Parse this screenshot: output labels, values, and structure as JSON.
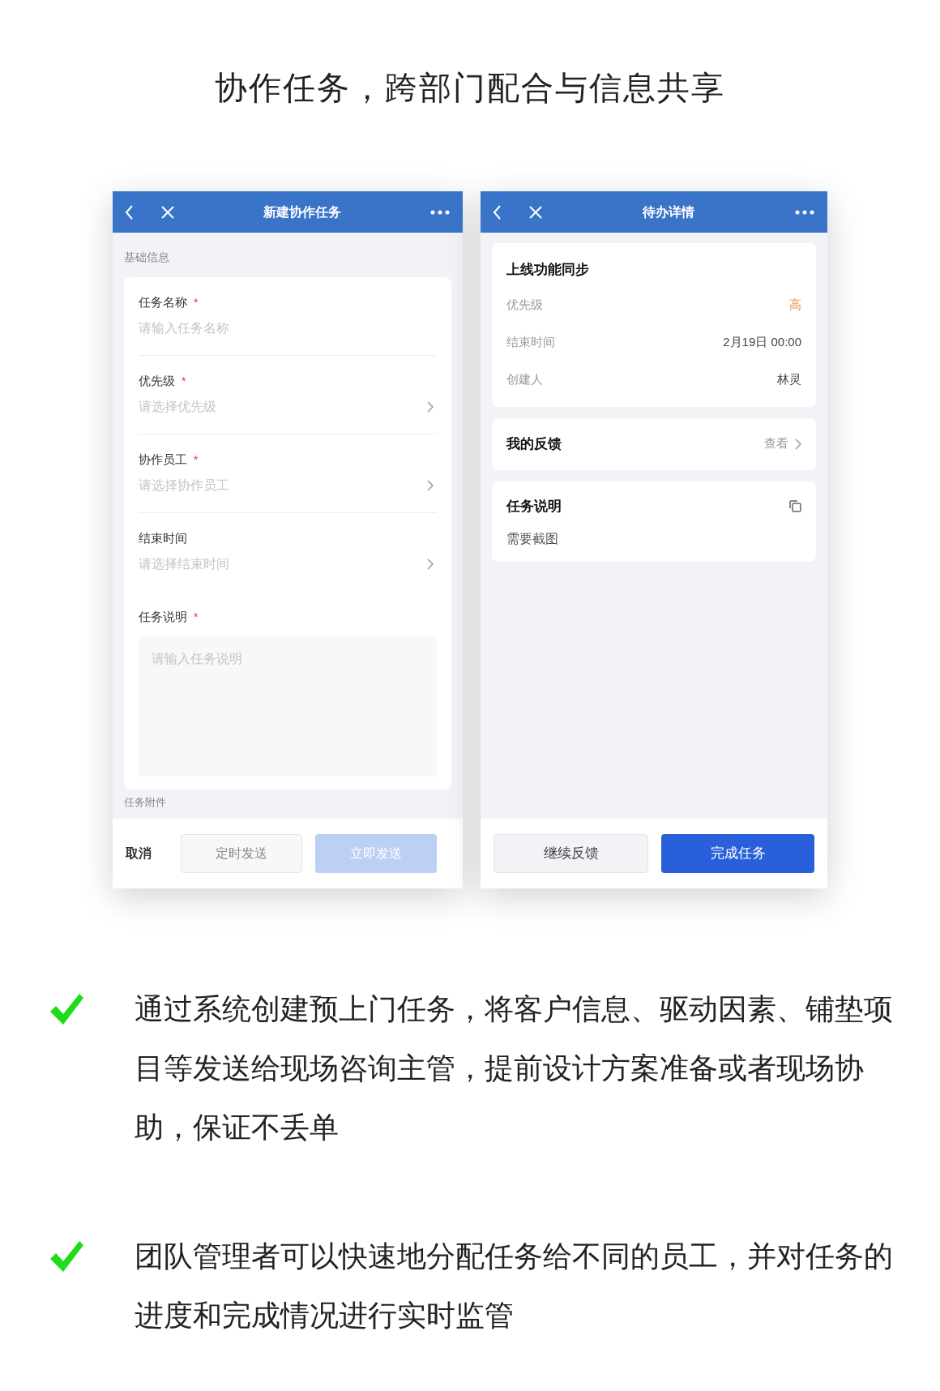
{
  "headline": "协作任务，跨部门配合与信息共享",
  "left_screen": {
    "title": "新建协作任务",
    "section": "基础信息",
    "fields": [
      {
        "kind": "input",
        "label": "任务名称",
        "required_mark": "*",
        "placeholder": "请输入任务名称"
      },
      {
        "kind": "select",
        "label": "优先级",
        "required_mark": "*",
        "placeholder": "请选择优先级"
      },
      {
        "kind": "select",
        "label": "协作员工",
        "required_mark": "*",
        "placeholder": "请选择协作员工"
      },
      {
        "kind": "select",
        "label": "结束时间",
        "placeholder": "请选择结束时间"
      },
      {
        "kind": "textarea",
        "label": "任务说明",
        "required_mark": "*",
        "placeholder": "请输入任务说明"
      }
    ],
    "next_section": "任务附件",
    "footer": {
      "cancel": "取消",
      "scheduled": "定时发送",
      "send": {
        "label": "立即发送",
        "disabled": true
      }
    }
  },
  "right_screen": {
    "title": "待办详情",
    "task_title": "上线功能同步",
    "details": [
      {
        "label": "优先级",
        "value": "高",
        "kind": "priority"
      },
      {
        "label": "结束时间",
        "value": "2月19日 00:00",
        "kind": "plain"
      },
      {
        "label": "创建人",
        "value": "林灵",
        "kind": "plain"
      }
    ],
    "feedback": {
      "title": "我的反馈",
      "link": "查看"
    },
    "description": {
      "title": "任务说明",
      "text": "需要截图"
    },
    "footer": {
      "secondary": "继续反馈",
      "primary": "完成任务"
    }
  },
  "bullets": [
    "通过系统创建预上门任务，将客户信息、驱动因素、铺垫项目等发送给现场咨询主管，提前设计方案准备或者现场协助，保证不丢单",
    "团队管理者可以快速地分配任务给不同的员工，并对任务的进度和完成情况进行实时监管"
  ]
}
